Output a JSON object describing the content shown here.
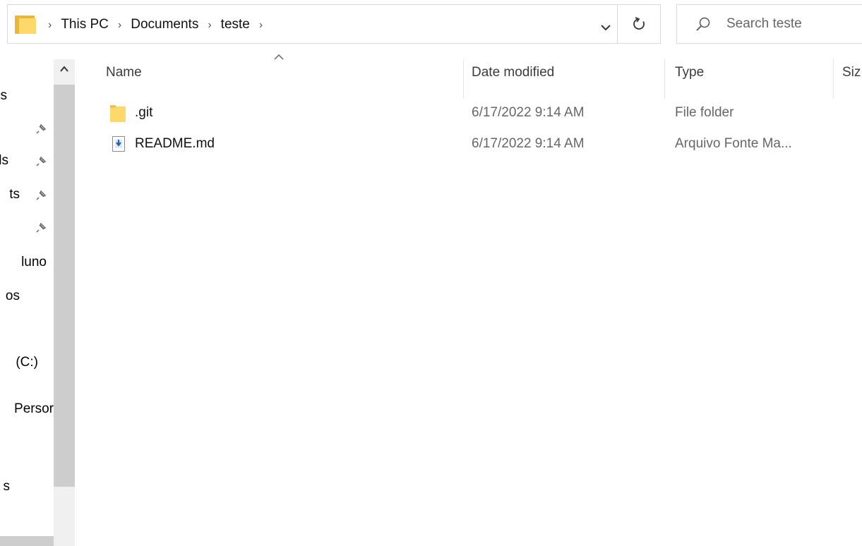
{
  "address_bar": {
    "crumbs": [
      "This PC",
      "Documents",
      "teste"
    ],
    "separator": "›"
  },
  "search": {
    "placeholder": "Search teste"
  },
  "nav_pane": {
    "items": [
      {
        "label": "ss"
      },
      {
        "label": ""
      },
      {
        "label": "ls"
      },
      {
        "label": "ts"
      },
      {
        "label": ""
      },
      {
        "label": "luno"
      },
      {
        "label": "os"
      },
      {
        "label": "(C:)"
      },
      {
        "label": "Persor"
      },
      {
        "label": "s"
      }
    ]
  },
  "columns": {
    "name": "Name",
    "date": "Date modified",
    "type": "Type",
    "size": "Siz"
  },
  "files": [
    {
      "name": ".git",
      "date": "6/17/2022 9:14 AM",
      "type": "File folder",
      "icon": "folder-icon"
    },
    {
      "name": "README.md",
      "date": "6/17/2022 9:14 AM",
      "type": "Arquivo Fonte Ma...",
      "icon": "markdown-file-icon"
    }
  ],
  "colors": {
    "folder_front": "#ffd86b",
    "folder_back": "#e8b53f",
    "border": "#d9d9d9",
    "scroll_track": "#f0f0f0",
    "scroll_thumb": "#cdcdcd"
  }
}
